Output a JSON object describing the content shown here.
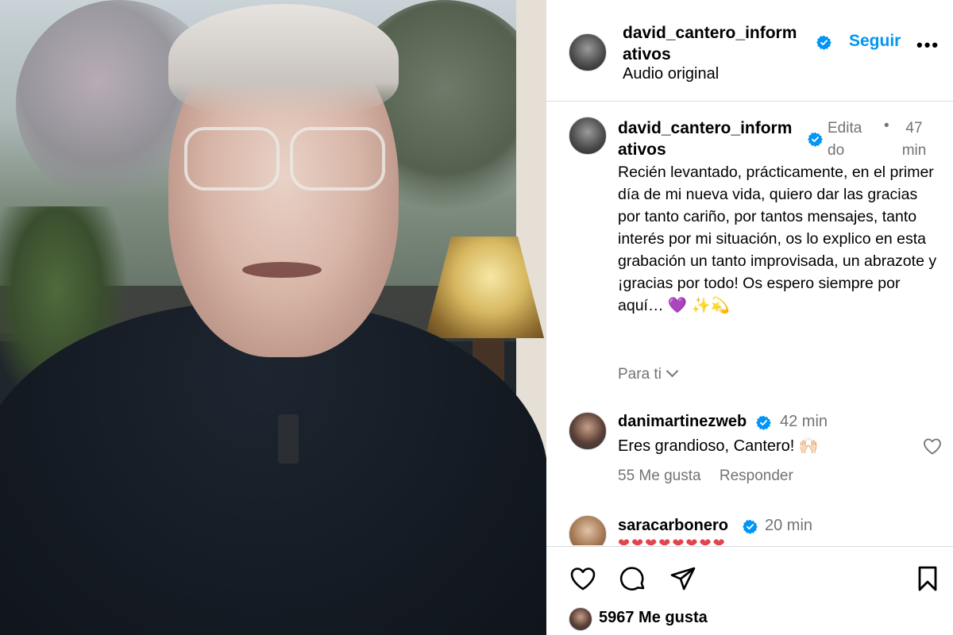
{
  "post": {
    "username": "david_cantero_informativos",
    "username_line1": "david_cantero_inform",
    "username_line2": "ativos",
    "follow_label": "Seguir",
    "audio_label": "Audio original",
    "more_label": "•••"
  },
  "caption": {
    "username_line1": "david_cantero_inform",
    "username_line2": "ativos",
    "edited_line1": "Edita",
    "edited_line2": "do",
    "separator": "•",
    "time_line1": "47",
    "time_line2": "min",
    "text": "Recién levantado, prácticamente, en el primer día de mi nueva vida, quiero dar las gracias por tanto cariño, por tantos mensajes, tanto interés por mi situación, os lo explico en esta grabación un tanto improvisada, un abrazote y ¡gracias por todo! Os espero siempre por aquí… 💜 ✨💫"
  },
  "for_you": {
    "label": "Para ti"
  },
  "comments": [
    {
      "username": "danimartinezweb",
      "time": "42 min",
      "text": "Eres grandioso, Cantero! 🙌🏻",
      "likes": "55 Me gusta",
      "reply": "Responder"
    },
    {
      "username": "saracarbonero",
      "time": "20 min",
      "text": "❤❤❤❤❤❤❤❤"
    }
  ],
  "footer": {
    "likes": "5967 Me gusta"
  },
  "icons": {
    "like": "heart-icon",
    "comment": "comment-icon",
    "share": "paper-plane-icon",
    "save": "bookmark-icon",
    "verified": "verified-badge-icon"
  },
  "colors": {
    "accent": "#0095f6",
    "secondary_text": "#737373",
    "divider": "#dbdbdb"
  }
}
